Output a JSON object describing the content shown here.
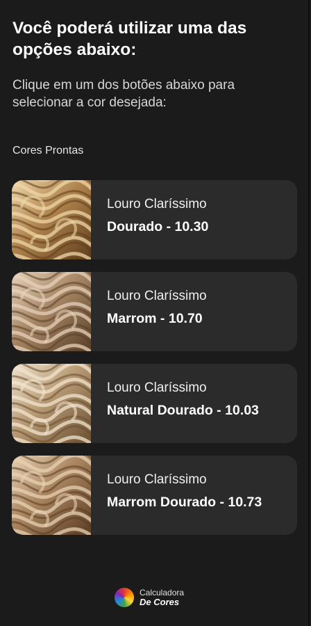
{
  "header": {
    "title": "Você poderá utilizar uma das opções abaixo:",
    "subtitle": "Clique em um dos botões abaixo para selecionar a cor desejada:"
  },
  "section": {
    "label": "Cores Prontas"
  },
  "colors": [
    {
      "line1": "Louro Claríssimo",
      "line2": "Dourado - 10.30",
      "swatch": {
        "base": "#b0844e",
        "light": "#efd7a8",
        "dark": "#5e3d1c"
      }
    },
    {
      "line1": "Louro Claríssimo",
      "line2": "Marrom - 10.70",
      "swatch": {
        "base": "#a78765",
        "light": "#e6d2bb",
        "dark": "#5a4028"
      }
    },
    {
      "line1": "Louro Claríssimo",
      "line2": "Natural Dourado - 10.03",
      "swatch": {
        "base": "#b89b75",
        "light": "#f1e4cf",
        "dark": "#6a4f31"
      }
    },
    {
      "line1": "Louro Claríssimo",
      "line2": "Marrom Dourado - 10.73",
      "swatch": {
        "base": "#a98560",
        "light": "#e8d2b4",
        "dark": "#5b3d22"
      }
    }
  ],
  "footer": {
    "brand_top": "Calculadora",
    "brand_bottom": "De Cores"
  }
}
